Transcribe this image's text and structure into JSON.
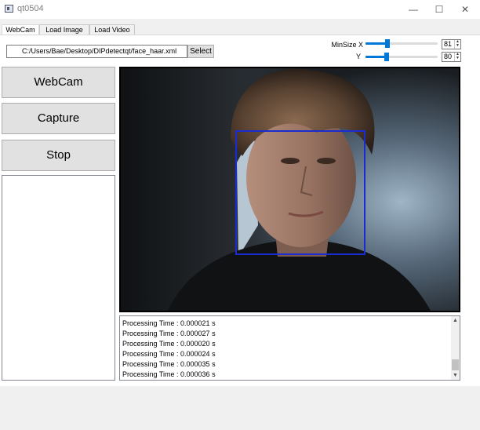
{
  "window": {
    "title": "qt0504"
  },
  "tabs": [
    {
      "label": "WebCam",
      "active": true
    },
    {
      "label": "Load Image",
      "active": false
    },
    {
      "label": "Load Video",
      "active": false
    }
  ],
  "cascade": {
    "path": "C:/Users/Bae/Desktop/DIPdetectqt/face_haar.xml",
    "select_label": "Select"
  },
  "controls": {
    "minsize_x_label": "MinSize X",
    "y_label": "Y",
    "minsize_x_value": "81",
    "y_value": "80"
  },
  "buttons": {
    "webcam": "WebCam",
    "capture": "Capture",
    "stop": "Stop"
  },
  "log": {
    "lines": [
      "Processing Time : 0.000021 s",
      "Processing Time : 0.000027 s",
      "Processing Time : 0.000020 s",
      "Processing Time : 0.000024 s",
      "Processing Time : 0.000035 s",
      "Processing Time : 0.000036 s"
    ]
  },
  "colors": {
    "accent": "#0078d7",
    "detection_box": "#1a2bd0"
  },
  "icons": {
    "minimize": "minimize-icon",
    "maximize": "maximize-icon",
    "close": "close-icon"
  }
}
